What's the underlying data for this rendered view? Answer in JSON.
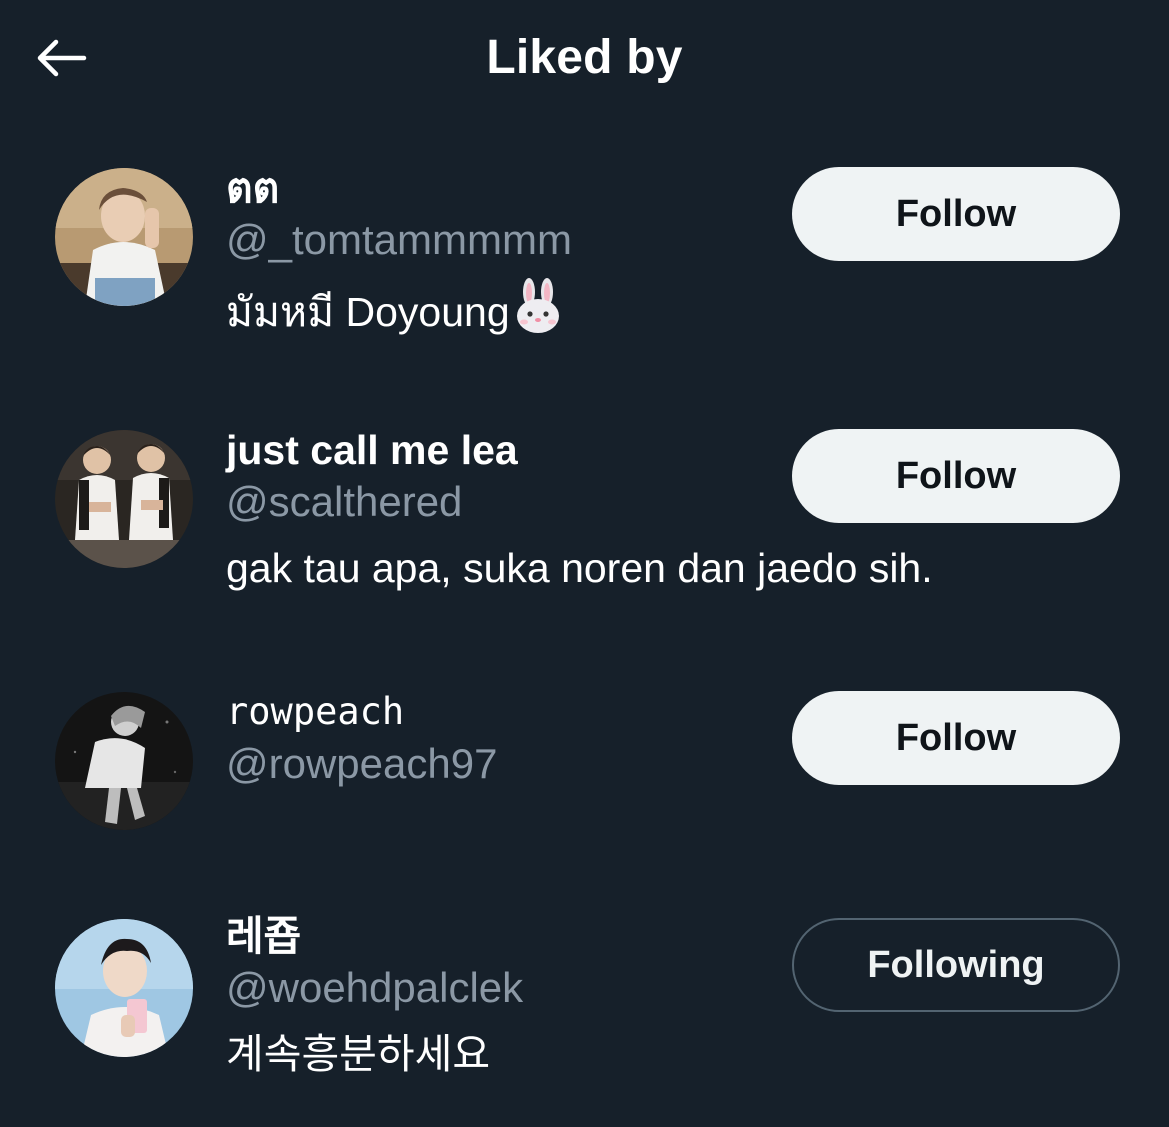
{
  "header": {
    "title": "Liked by",
    "back_icon": "arrow-left-icon"
  },
  "users": [
    {
      "name": "ตต",
      "handle": "@_tomtammmmm",
      "bio": "มัมหมี Doyoung",
      "bio_emoji": "rabbit-face-emoji",
      "button": "Follow"
    },
    {
      "name": "just call me lea",
      "handle": "@scalthered",
      "bio": "gak tau apa, suka noren dan jaedo sih.",
      "button": "Follow"
    },
    {
      "name": "rowpeach",
      "handle": "@rowpeach97",
      "bio": "",
      "button": "Follow"
    },
    {
      "name": "레죱",
      "handle": "@woehdpalclek",
      "bio": "계속흥분하세요",
      "button": "Following"
    }
  ],
  "colors": {
    "background": "#16202a",
    "secondary_text": "#8b98a5",
    "follow_button_bg": "#eff3f4",
    "following_border": "#536471"
  }
}
